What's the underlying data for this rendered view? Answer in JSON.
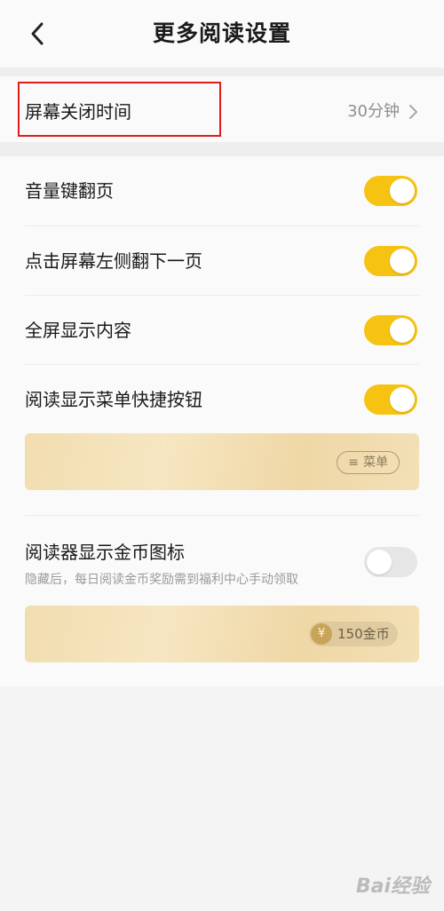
{
  "header": {
    "title": "更多阅读设置",
    "back_icon": "chevron-left-icon"
  },
  "screen_off": {
    "label": "屏幕关闭时间",
    "value": "30分钟",
    "chevron_icon": "chevron-right-icon"
  },
  "settings": [
    {
      "label": "音量键翻页",
      "enabled": true
    },
    {
      "label": "点击屏幕左侧翻下一页",
      "enabled": true
    },
    {
      "label": "全屏显示内容",
      "enabled": true
    },
    {
      "label": "阅读显示菜单快捷按钮",
      "enabled": true
    }
  ],
  "menu_preview": {
    "icon": "≡",
    "label": "菜单"
  },
  "coins_setting": {
    "label": "阅读器显示金币图标",
    "description": "隐藏后，每日阅读金币奖励需到福利中心手动领取",
    "enabled": false
  },
  "coin_preview": {
    "icon": "¥",
    "label": "150金币"
  },
  "watermark": "Bai经验",
  "colors": {
    "accent": "#f6c312",
    "highlight": "#e21b1b"
  }
}
